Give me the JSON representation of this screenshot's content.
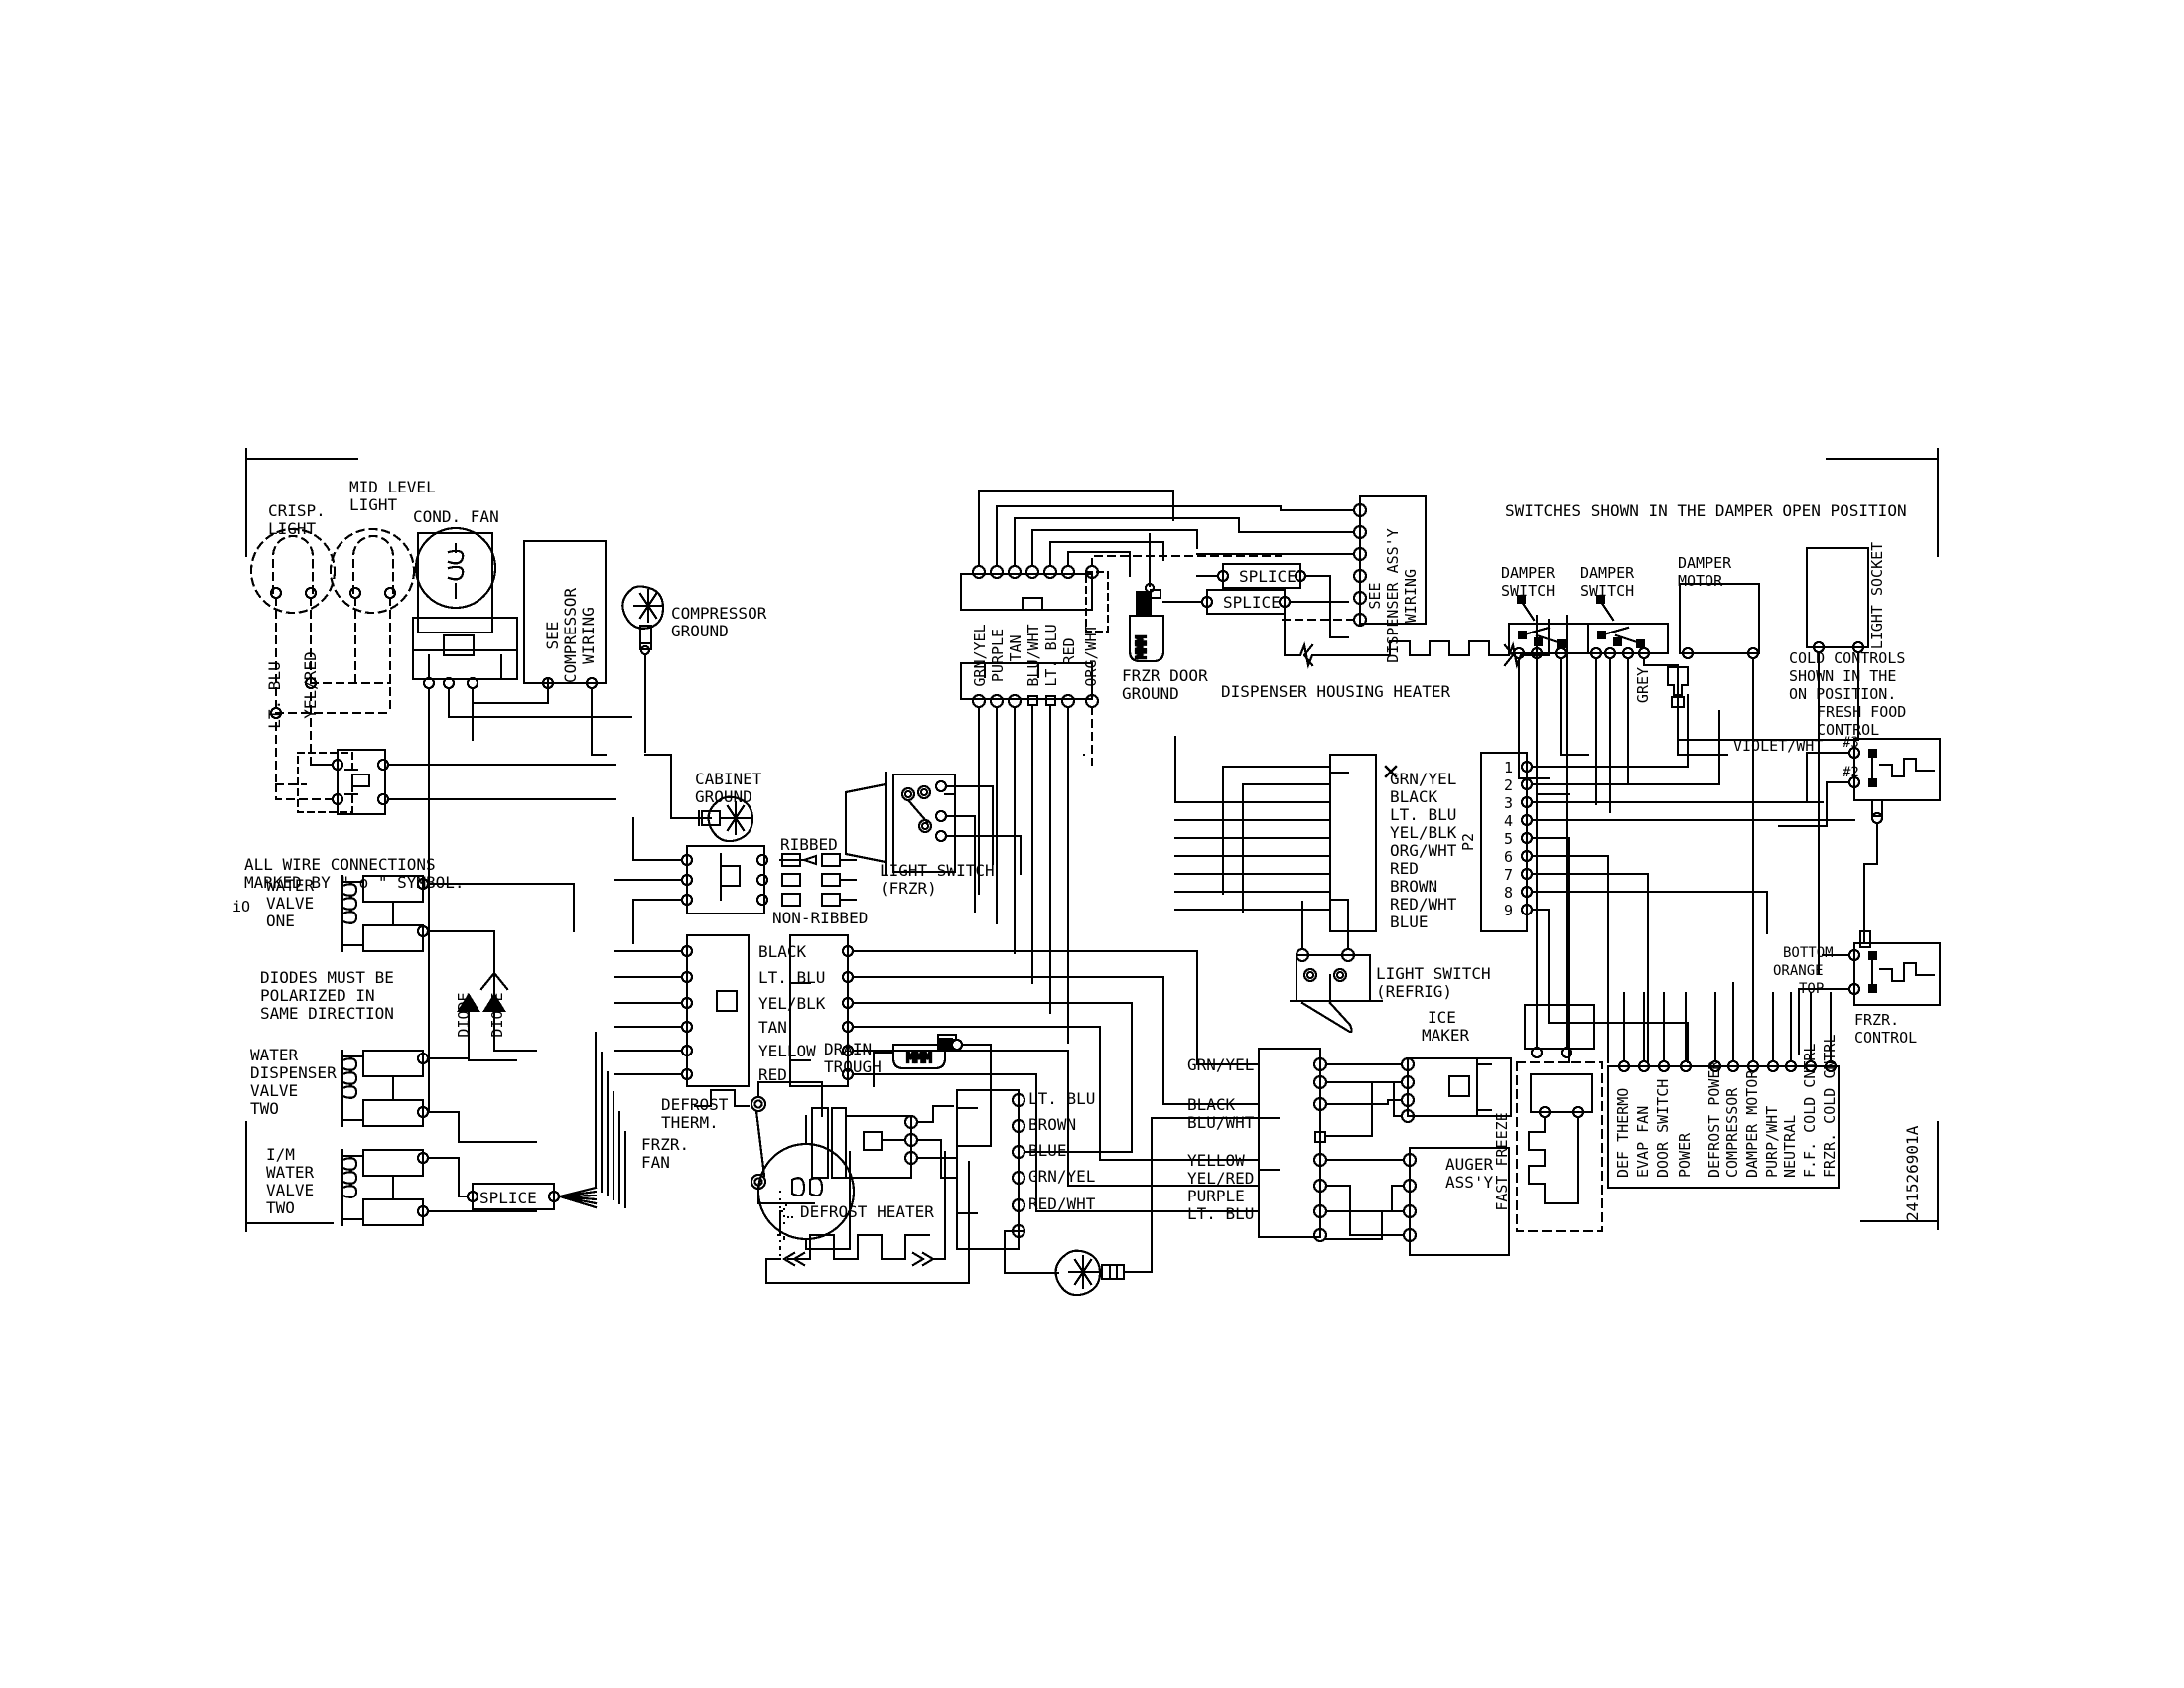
{
  "document": {
    "type": "refrigerator-wiring-schematic",
    "part_number": "241526901A",
    "stray_mark": "iO"
  },
  "notes": {
    "wire_connections": [
      "ALL WIRE CONNECTIONS",
      "MARKED BY \" o \" SYMBOL."
    ],
    "diodes": [
      "DIODES MUST BE",
      "POLARIZED IN",
      "SAME DIRECTION"
    ],
    "damper": "SWITCHES SHOWN IN THE DAMPER OPEN POSITION",
    "cold_controls": [
      "COLD CONTROLS",
      "SHOWN IN THE",
      "ON POSITION."
    ]
  },
  "components": {
    "crisp_light": [
      "CRISP.",
      "LIGHT"
    ],
    "mid_level_light": [
      "MID LEVEL",
      "LIGHT"
    ],
    "cond_fan": "COND. FAN",
    "see_compressor_wiring": [
      "SEE",
      "COMPRESSOR",
      "WIRING"
    ],
    "compressor_ground": [
      "COMPRESSOR",
      "GROUND"
    ],
    "cabinet_ground": [
      "CABINET",
      "GROUND"
    ],
    "ribbed": "RIBBED",
    "non_ribbed": "NON-RIBBED",
    "water_valve_one": [
      "WATER",
      "VALVE",
      "ONE"
    ],
    "water_dispenser_valve_two": [
      "WATER",
      "DISPENSER",
      "VALVE",
      "TWO"
    ],
    "im_water_valve_two": [
      "I/M",
      "WATER",
      "VALVE",
      "TWO"
    ],
    "diode_left": "DIODE",
    "diode_right": "DIODE",
    "splice": "SPLICE",
    "light_switch_frzr": [
      "LIGHT SWITCH",
      "(FRZR)"
    ],
    "light_switch_refrig": [
      "LIGHT SWITCH",
      "(REFRIG)"
    ],
    "drain_trough": [
      "DRAIN",
      "TROUGH"
    ],
    "defrost_therm": [
      "DEFROST",
      "THERM."
    ],
    "frzr_fan": [
      "FRZR.",
      "FAN"
    ],
    "defrost_heater": "DEFROST HEATER",
    "frzr_door_ground": [
      "FRZR DOOR",
      "GROUND"
    ],
    "dispenser_housing_heater": "DISPENSER HOUSING HEATER",
    "see_dispenser_assy_wiring": [
      "SEE",
      "DISPENSER ASS'Y",
      "WIRING"
    ],
    "damper_switch_1": [
      "DAMPER",
      "SWITCH"
    ],
    "damper_switch_2": [
      "DAMPER",
      "SWITCH"
    ],
    "damper_motor": [
      "DAMPER",
      "MOTOR"
    ],
    "grey": "GREY",
    "light_socket": "LIGHT SOCKET",
    "violet_wht": "VIOLET/WHT",
    "fresh_food_control": [
      "FRESH FOOD",
      "CONTROL"
    ],
    "frzr_control": [
      "FRZR.",
      "CONTROL"
    ],
    "bottom": "BOTTOM",
    "orange": "ORANGE",
    "top": "TOP",
    "ice_maker": [
      "ICE",
      "MAKER"
    ],
    "auger_assy": [
      "AUGER",
      "ASS'Y"
    ],
    "fast_freeze": "FAST FREEZE",
    "p2": "P2"
  },
  "wire_labels": {
    "left_lamp_group": [
      "LT. BLU",
      "YEL/RED"
    ],
    "cabinet_connector": [
      "BLACK",
      "LT. BLU",
      "YEL/BLK",
      "TAN",
      "YELLOW",
      "RED"
    ],
    "dispenser_connector": [
      "GRN/YEL",
      "PURPLE",
      "TAN",
      "BLU/WHT",
      "LT. BLU",
      "RED",
      "ORG/WHT"
    ],
    "frzr_fan_connector": [
      "LT. BLU",
      "BROWN",
      "BLUE",
      "GRN/YEL",
      "RED/WHT"
    ],
    "main_board_left": [
      "GRN/YEL",
      "BLACK",
      "LT. BLU",
      "YEL/BLK",
      "ORG/WHT",
      "RED",
      "BROWN",
      "RED/WHT",
      "BLUE"
    ],
    "ice_maker_connector": [
      "GRN/YEL",
      "BLACK",
      "BLU/WHT",
      "YELLOW",
      "YEL/RED",
      "PURPLE",
      "LT. BLU"
    ]
  },
  "p2_pins": [
    "1",
    "2",
    "3",
    "4",
    "5",
    "6",
    "7",
    "8",
    "9"
  ],
  "control_board_terminals": [
    "DEF THERMO",
    "EVAP FAN",
    "DOOR SWITCH",
    "POWER",
    "DEFROST POWER",
    "COMPRESSOR",
    "DAMPER MOTOR",
    "PURP/WHT",
    "NEUTRAL",
    "F.F. COLD CNTRL",
    "FRZR. COLD CNTRL"
  ],
  "control_pins": {
    "fresh_food": [
      "#3",
      "#2"
    ]
  },
  "colors": {
    "line": "#000000",
    "background": "#ffffff"
  }
}
